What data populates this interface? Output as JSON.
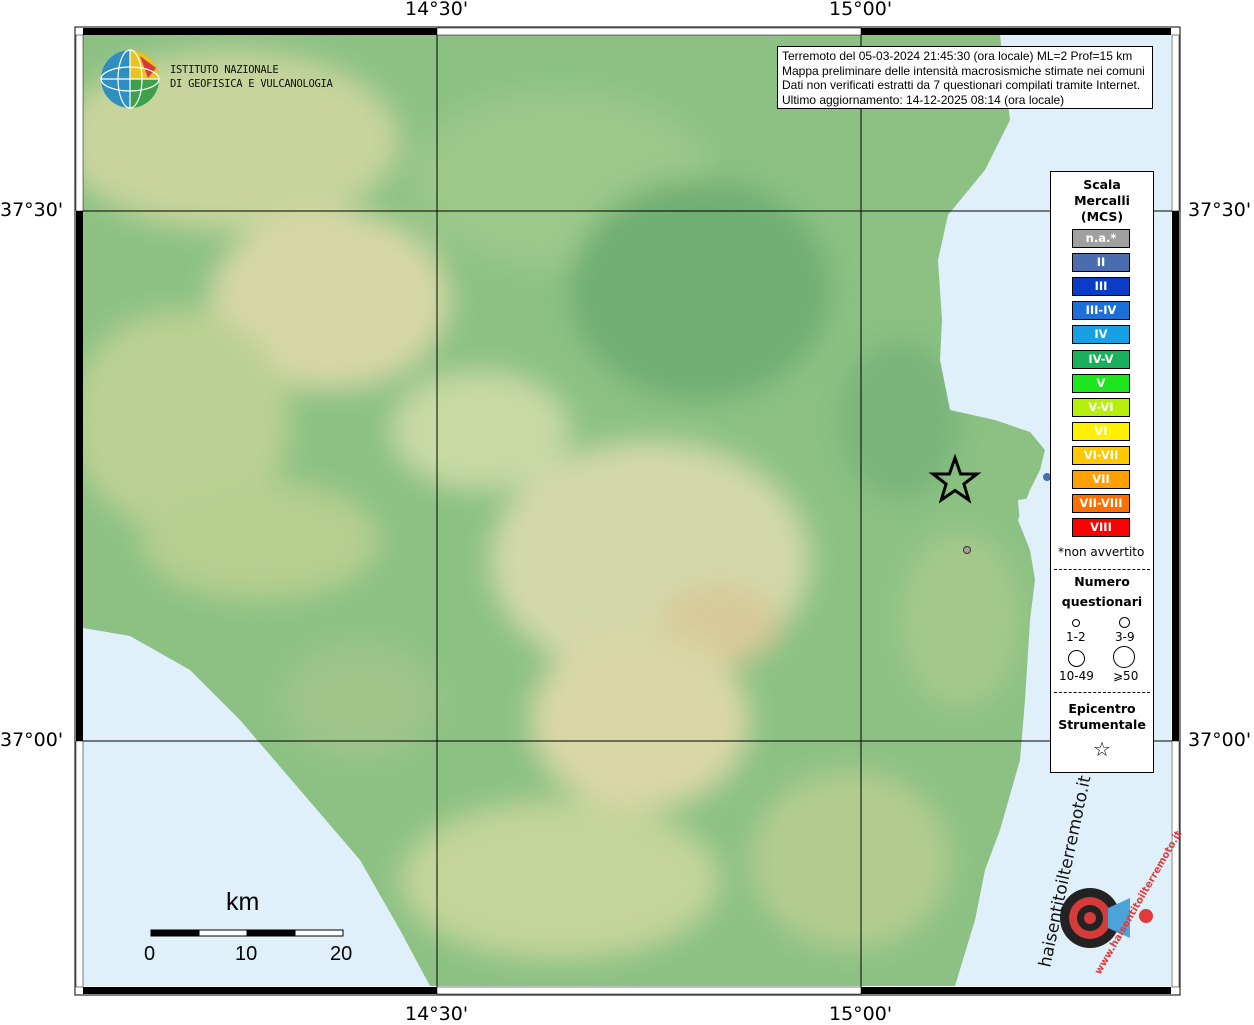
{
  "map": {
    "top_labels": [
      "14°30'",
      "15°00'"
    ],
    "bottom_labels": [
      "14°30'",
      "15°00'"
    ],
    "left_labels": [
      "37°30'",
      "37°00'"
    ],
    "right_labels": [
      "37°30'",
      "37°00'"
    ],
    "colors": {
      "sea": "#dff0fb",
      "lowland": "#86bd80",
      "hill": "#a9cd8c",
      "plateau": "#d6ddb0",
      "highland": "#d8cf9f",
      "grid": "#000000"
    }
  },
  "info": {
    "line1": "Terremoto del 05-03-2024 21:45:30 (ora locale) ML=2 Prof=15 km",
    "line2": "Mappa preliminare delle intensità macrosismiche stimate nei comuni",
    "line3": "Dati non verificati estratti da 7 questionari compilati tramite Internet.",
    "line4": "Ultimo aggiornamento: 14-12-2025 08:14 (ora locale)"
  },
  "logo": {
    "line1": "ISTITUTO NAZIONALE",
    "line2": "DI GEOFISICA E VULCANOLOGIA"
  },
  "legend": {
    "title_line1": "Scala",
    "title_line2": "Mercalli",
    "title_line3": "(MCS)",
    "scale": [
      {
        "label": "n.a.*",
        "color": "#a0a0a0"
      },
      {
        "label": "II",
        "color": "#4c6cb0"
      },
      {
        "label": "III",
        "color": "#0a3cc8"
      },
      {
        "label": "III-IV",
        "color": "#1c6fd6"
      },
      {
        "label": "IV",
        "color": "#18a0e6"
      },
      {
        "label": "IV-V",
        "color": "#18b05a"
      },
      {
        "label": "V",
        "color": "#1ee61e"
      },
      {
        "label": "V-VI",
        "color": "#b4f00a"
      },
      {
        "label": "VI",
        "color": "#fff000"
      },
      {
        "label": "VI-VII",
        "color": "#ffc800"
      },
      {
        "label": "VII",
        "color": "#ffa000"
      },
      {
        "label": "VII-VIII",
        "color": "#ff6e00"
      },
      {
        "label": "VIII",
        "color": "#ff0000"
      }
    ],
    "not_felt": "*non avvertito",
    "count_title_line1": "Numero",
    "count_title_line2": "questionari",
    "count_classes": [
      "1-2",
      "3-9",
      "10-49",
      "⩾50"
    ],
    "epicenter_line1": "Epicentro",
    "epicenter_line2": "Strumentale",
    "star_glyph": "☆"
  },
  "scalebar": {
    "unit": "km",
    "labels": [
      "0",
      "10",
      "20"
    ]
  },
  "branding": {
    "site_name": "haisentitoilterremoto.it",
    "site_url": "www.haisentitoilterremoto.it"
  },
  "observations": [
    {
      "intensity": "n.a.*",
      "count_class": "1-2"
    }
  ]
}
